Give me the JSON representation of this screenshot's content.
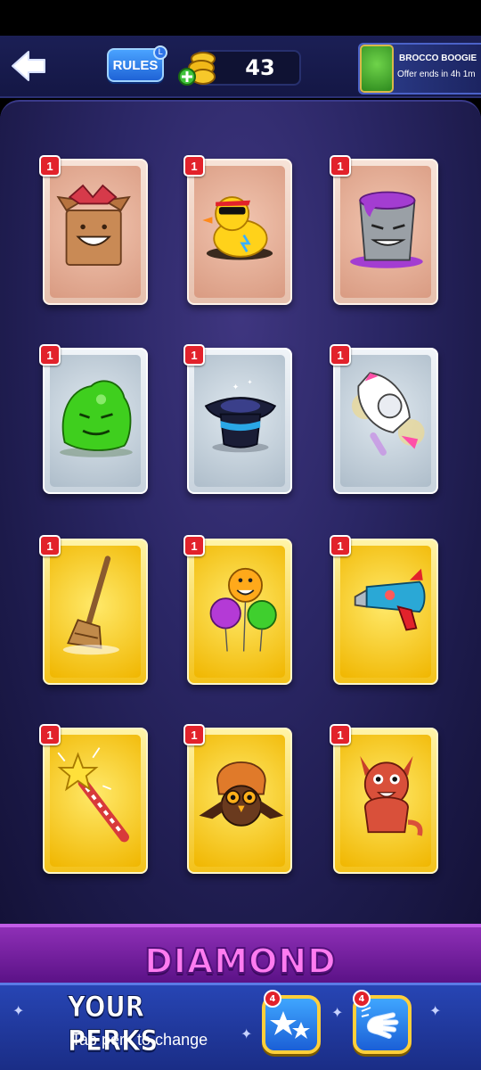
{
  "header": {
    "rules_label": "RULES",
    "rules_badge": "L",
    "coins_value": "43"
  },
  "offer": {
    "title": "BROCCO BOOGIE",
    "subtitle": "Offer ends in 4h 1m"
  },
  "cards": [
    {
      "badge": "1",
      "rarity": "bronze",
      "icon": "gift-box-character-icon"
    },
    {
      "badge": "1",
      "rarity": "bronze",
      "icon": "rubber-duck-sunglasses-icon"
    },
    {
      "badge": "1",
      "rarity": "bronze",
      "icon": "paint-bucket-character-icon"
    },
    {
      "badge": "1",
      "rarity": "silver",
      "icon": "green-jelly-character-icon"
    },
    {
      "badge": "1",
      "rarity": "silver",
      "icon": "magic-hat-icon"
    },
    {
      "badge": "1",
      "rarity": "silver",
      "icon": "rocket-character-icon"
    },
    {
      "badge": "1",
      "rarity": "gold",
      "icon": "broom-icon"
    },
    {
      "badge": "1",
      "rarity": "gold",
      "icon": "balloons-icon"
    },
    {
      "badge": "1",
      "rarity": "gold",
      "icon": "ray-gun-icon"
    },
    {
      "badge": "1",
      "rarity": "gold",
      "icon": "magic-wand-icon"
    },
    {
      "badge": "1",
      "rarity": "gold",
      "icon": "owl-icon"
    },
    {
      "badge": "1",
      "rarity": "gold",
      "icon": "red-dragon-icon"
    }
  ],
  "banner_title": "DIAMOND BOOSTERS",
  "perks": {
    "title": "YOUR PERKS",
    "subtitle": "Tap perk to change",
    "items": [
      {
        "badge": "4",
        "icon": "stars-perk-icon"
      },
      {
        "badge": "4",
        "icon": "swipe-hand-perk-icon"
      }
    ]
  },
  "colors": {
    "bronze": "#e6c0ad",
    "silver": "#c8d3dd",
    "gold": "#f3c21b",
    "badge_red": "#e2222b",
    "banner_pink": "#ff7cf0"
  }
}
